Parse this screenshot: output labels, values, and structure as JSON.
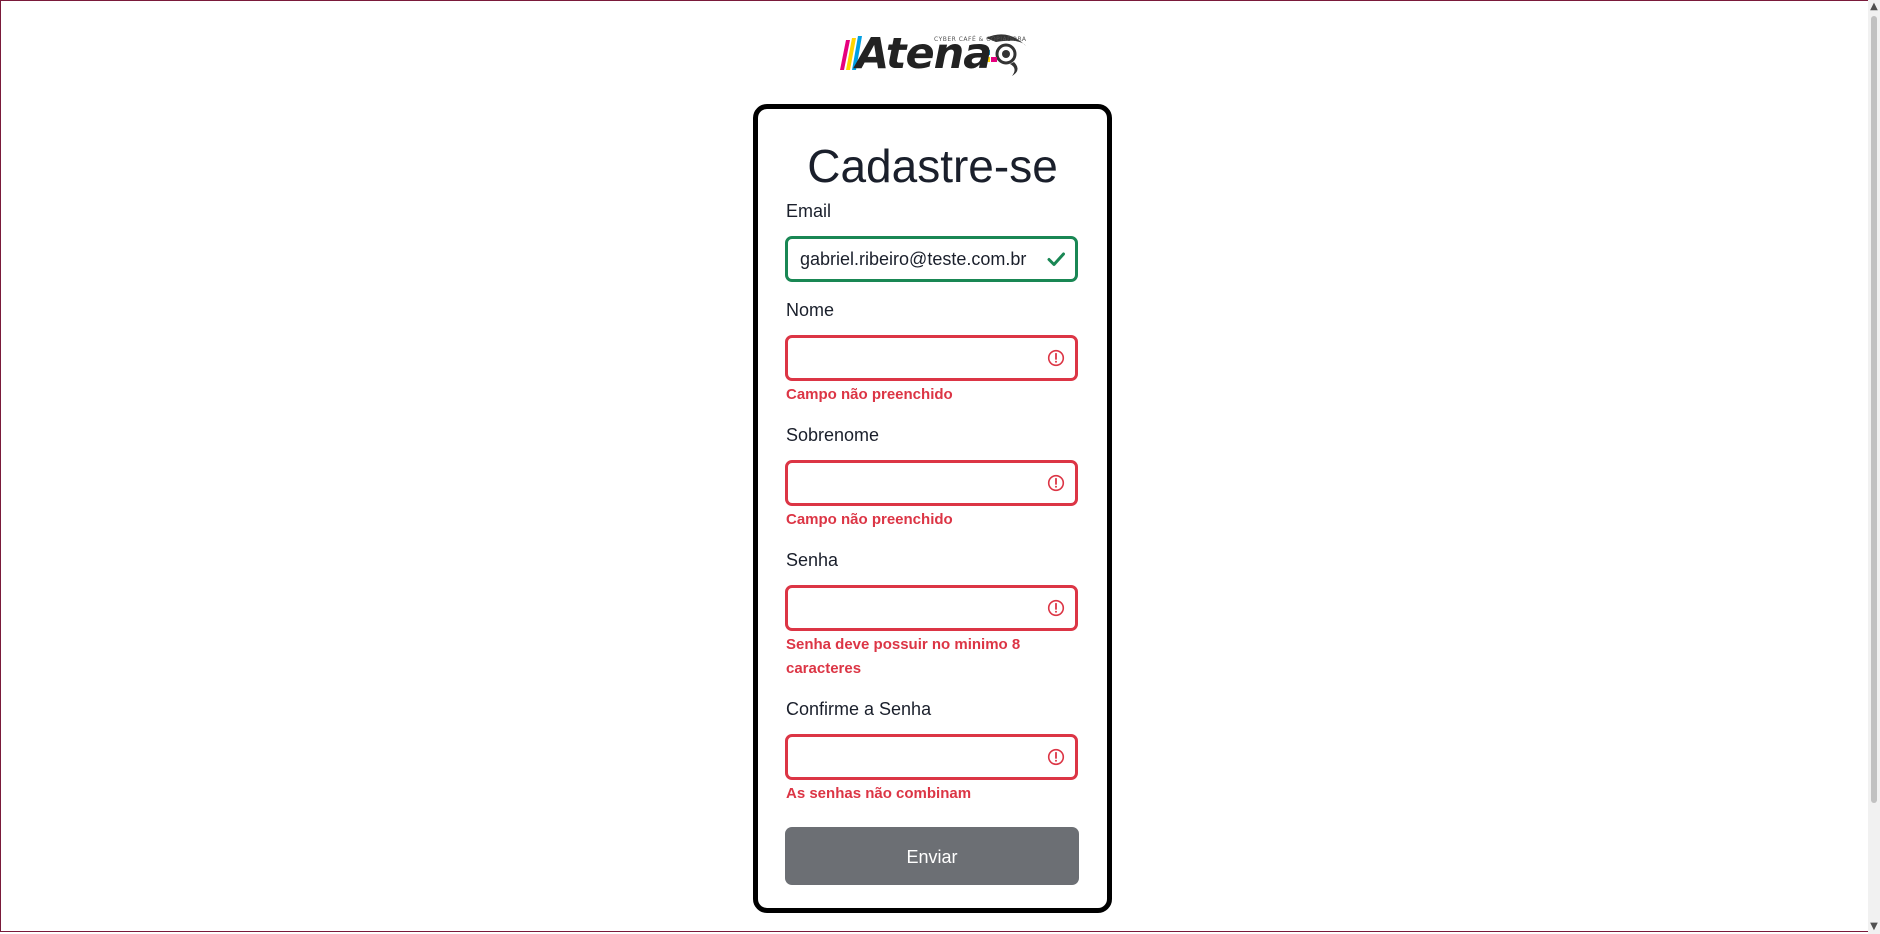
{
  "logo": {
    "wordmark": "Atena",
    "tagline": "CYBER CAFÉ & COPIADORA"
  },
  "form": {
    "title": "Cadastre-se",
    "fields": [
      {
        "label": "Email",
        "value": "gabriel.ribeiro@teste.com.br",
        "status": "valid",
        "icon": "check-icon",
        "error": ""
      },
      {
        "label": "Nome",
        "value": "",
        "status": "invalid",
        "icon": "alert-circle-icon",
        "error": "Campo não preenchido"
      },
      {
        "label": "Sobrenome",
        "value": "",
        "status": "invalid",
        "icon": "alert-circle-icon",
        "error": "Campo não preenchido"
      },
      {
        "label": "Senha",
        "value": "",
        "status": "invalid",
        "icon": "alert-circle-icon",
        "error": "Senha deve possuir no minimo 8 caracteres"
      },
      {
        "label": "Confirme a Senha",
        "value": "",
        "status": "invalid",
        "icon": "alert-circle-icon",
        "error": "As senhas não combinam"
      }
    ],
    "submit_label": "Enviar"
  },
  "colors": {
    "valid": "#198754",
    "invalid": "#dc3545",
    "button": "#6c6f74",
    "text": "#1a1f2b"
  }
}
